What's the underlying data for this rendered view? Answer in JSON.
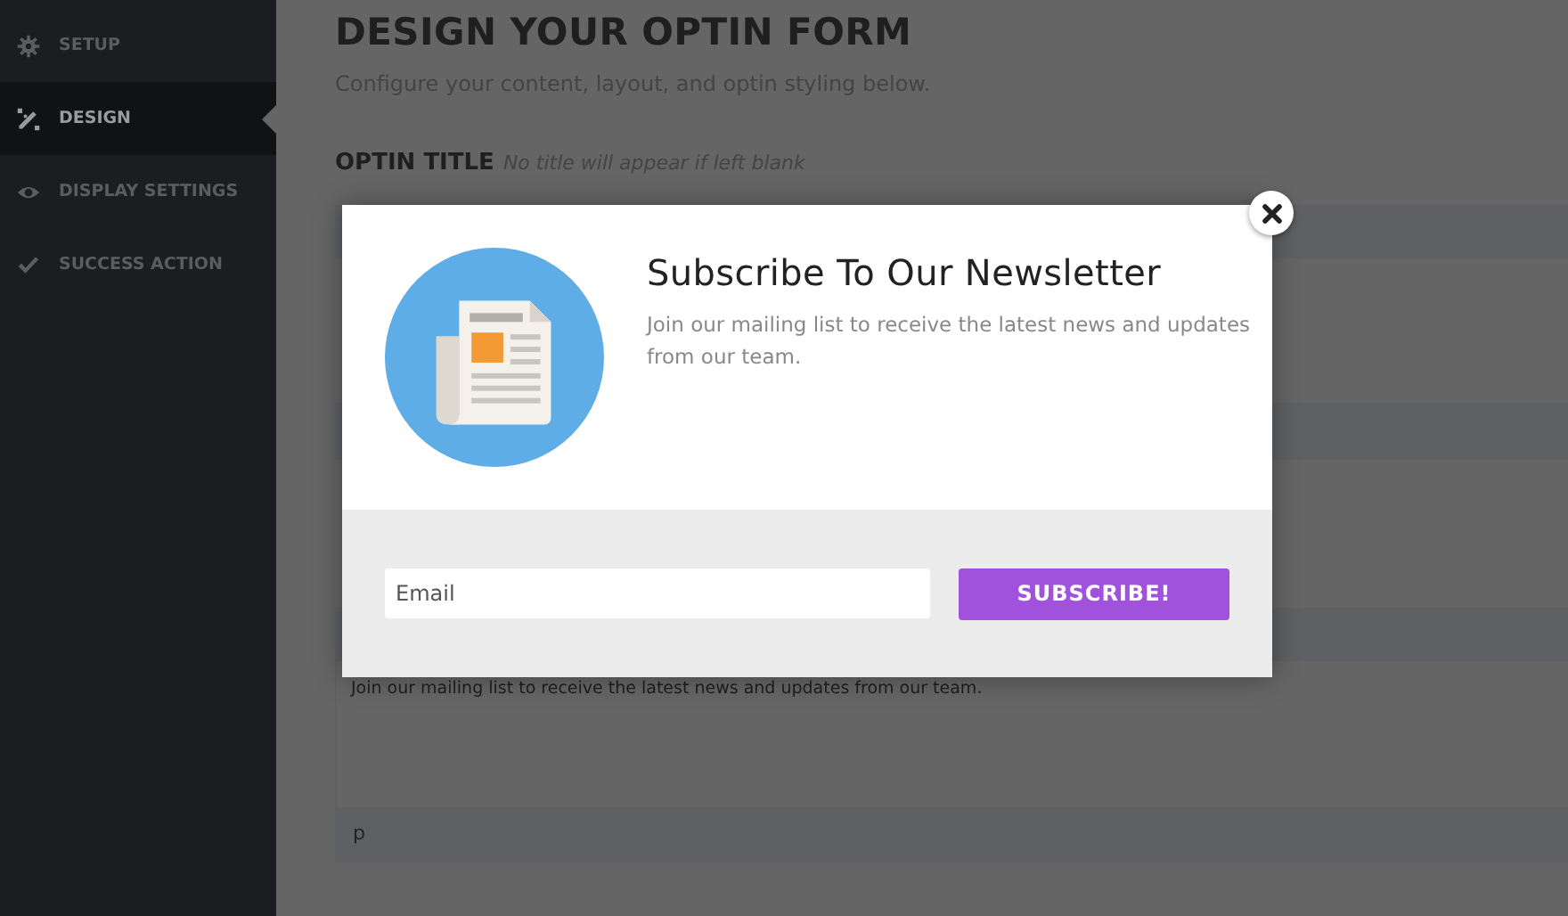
{
  "sidebar": {
    "items": [
      {
        "label": "SETUP",
        "kind": "gear",
        "selected": false
      },
      {
        "label": "DESIGN",
        "kind": "pencil",
        "selected": true
      },
      {
        "label": "DISPLAY SETTINGS",
        "kind": "eye",
        "selected": false
      },
      {
        "label": "SUCCESS ACTION",
        "kind": "check",
        "selected": false
      }
    ]
  },
  "page": {
    "title": "DESIGN YOUR OPTIN FORM",
    "subtitle": "Configure your content, layout, and optin styling below.",
    "optin_title": {
      "label": "OPTIN TITLE",
      "hint": "No title will appear if left blank"
    },
    "message_text": "Join our mailing list to receive the latest news and updates from our team.",
    "tag_field": "p"
  },
  "modal": {
    "title": "Subscribe To Our Newsletter",
    "description": "Join our mailing list to receive the latest news and updates from our team.",
    "email": {
      "placeholder": "Email"
    },
    "button": "SUBSCRIBE!"
  }
}
